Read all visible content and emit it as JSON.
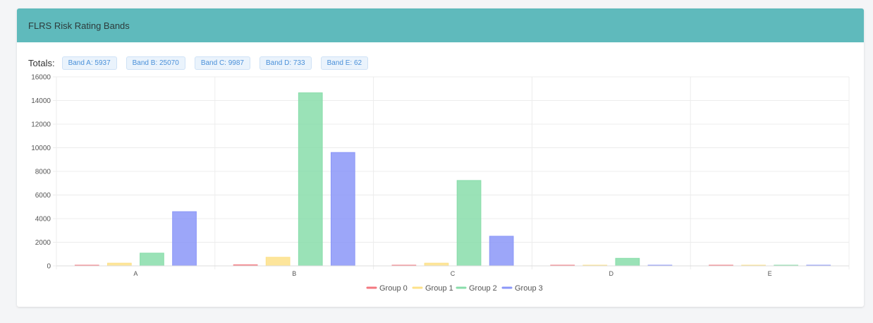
{
  "panel": {
    "title": "FLRS Risk Rating Bands"
  },
  "totals": {
    "label": "Totals:",
    "badges": [
      "Band A: 5937",
      "Band B: 25070",
      "Band C: 9987",
      "Band D: 733",
      "Band E: 62"
    ]
  },
  "colors": {
    "header": "#5fbabc",
    "badge_text": "#4a90d9",
    "group0": "#f3777f",
    "group1": "#fde189",
    "group2": "#88ddaa",
    "group3": "#8b97f8"
  },
  "chart_data": {
    "type": "bar",
    "categories": [
      "A",
      "B",
      "C",
      "D",
      "E"
    ],
    "series": [
      {
        "name": "Group 0",
        "values": [
          40,
          90,
          20,
          10,
          5
        ]
      },
      {
        "name": "Group 1",
        "values": [
          230,
          730,
          230,
          30,
          5
        ]
      },
      {
        "name": "Group 2",
        "values": [
          1080,
          14650,
          7230,
          640,
          40
        ]
      },
      {
        "name": "Group 3",
        "values": [
          4590,
          9600,
          2510,
          60,
          10
        ]
      }
    ],
    "ylim": [
      0,
      16000
    ],
    "yticks": [
      0,
      2000,
      4000,
      6000,
      8000,
      10000,
      12000,
      14000,
      16000
    ],
    "grid": true,
    "legend": "bottom"
  }
}
